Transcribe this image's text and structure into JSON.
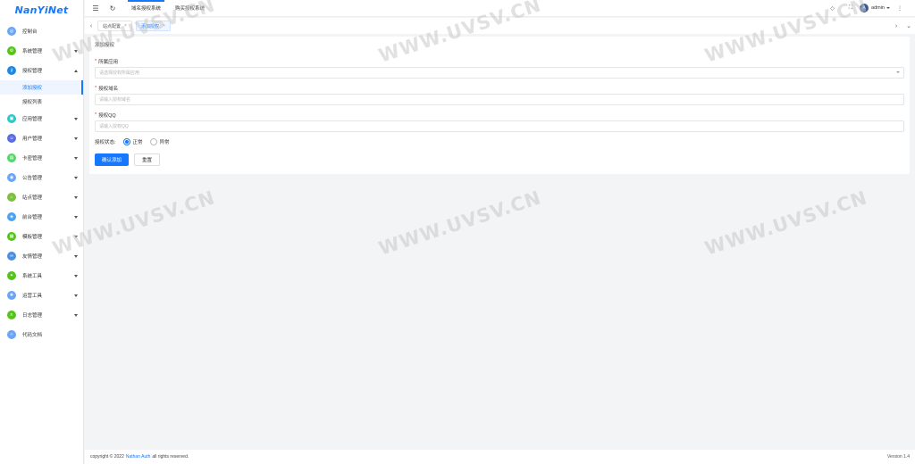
{
  "app": {
    "logo_text": "NanYiNet"
  },
  "sidebar": {
    "items": [
      {
        "label": "控制台",
        "icon": "dashboard-icon",
        "color": "#69a6f7",
        "chevron": ""
      },
      {
        "label": "系统管理",
        "icon": "settings-icon",
        "color": "#52c41a",
        "chevron": "down"
      },
      {
        "label": "授权管理",
        "icon": "key-icon",
        "color": "#1e88e5",
        "chevron": "up"
      },
      {
        "label": "应用管理",
        "icon": "app-icon",
        "color": "#2ec7c9",
        "chevron": "down"
      },
      {
        "label": "用户管理",
        "icon": "user-icon",
        "color": "#5b6ee1",
        "chevron": "down"
      },
      {
        "label": "卡密管理",
        "icon": "card-icon",
        "color": "#4cd964",
        "chevron": "down"
      },
      {
        "label": "公告管理",
        "icon": "notice-icon",
        "color": "#69a6f7",
        "chevron": "down"
      },
      {
        "label": "站点管理",
        "icon": "site-icon",
        "color": "#7bc043",
        "chevron": "down"
      },
      {
        "label": "前台管理",
        "icon": "frontend-icon",
        "color": "#4aa3f0",
        "chevron": "down"
      },
      {
        "label": "模板管理",
        "icon": "template-icon",
        "color": "#52c41a",
        "chevron": "down"
      },
      {
        "label": "友情管理",
        "icon": "link-icon",
        "color": "#4a90e2",
        "chevron": "down"
      },
      {
        "label": "系统工具",
        "icon": "tool-icon",
        "color": "#52c41a",
        "chevron": "down"
      },
      {
        "label": "运营工具",
        "icon": "ops-icon",
        "color": "#69a6f7",
        "chevron": "down"
      },
      {
        "label": "日志管理",
        "icon": "log-icon",
        "color": "#52c41a",
        "chevron": "down"
      },
      {
        "label": "代码文档",
        "icon": "doc-icon",
        "color": "#69a6f7",
        "chevron": ""
      }
    ],
    "sub_items": [
      {
        "label": "添加授权",
        "active": true
      },
      {
        "label": "授权列表",
        "active": false
      }
    ]
  },
  "topbar": {
    "nav": [
      {
        "label": "域名授权系统",
        "active": true
      },
      {
        "label": "购买授权系统",
        "active": false
      }
    ],
    "user": {
      "name": "admin",
      "avatar_text": "A"
    }
  },
  "tabs": [
    {
      "label": "站点配置",
      "active": false
    },
    {
      "label": "添加授权",
      "active": true
    }
  ],
  "form": {
    "title": "添加授权",
    "app_label": "所属应用",
    "app_placeholder": "请选择授权所属应用",
    "domain_label": "授权域名",
    "domain_placeholder": "请输入授权域名",
    "qq_label": "授权QQ",
    "qq_placeholder": "请输入授权QQ",
    "status_label": "授权状态:",
    "status_options": [
      "正常",
      "异常"
    ],
    "status_selected": "正常",
    "submit_label": "确认添加",
    "reset_label": "重置"
  },
  "footer": {
    "prefix": "copyright © 2022",
    "link": "Nathan Auth",
    "suffix": "all rights reserved.",
    "version": "Version 1.4"
  },
  "watermark": "WWW.UVSV.CN"
}
